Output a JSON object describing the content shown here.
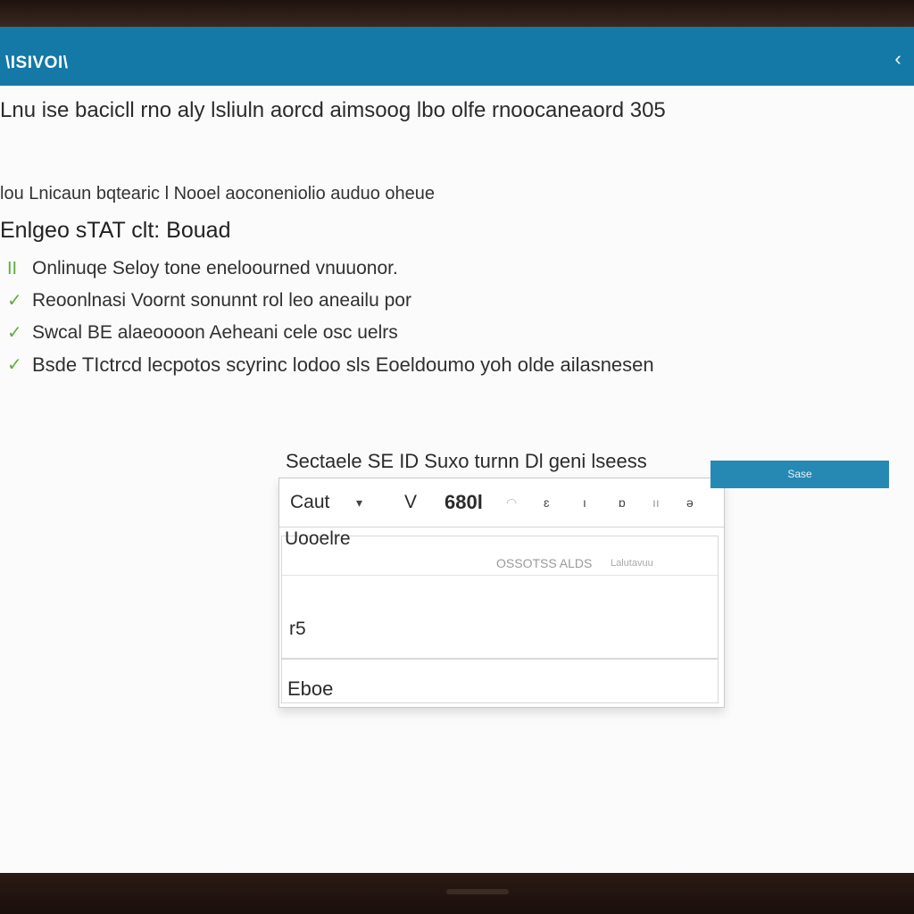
{
  "window": {
    "title": "\\ISIVOI\\",
    "back_icon": "chevron-left-icon"
  },
  "content": {
    "headline": "Lnu ise bacicll rno aly lsliuln aorcd aimsoog lbo olfe rnoocaneaord 305",
    "subline": "lou Lnicaun bqtearic l Nooel aoconeniolio auduo oheue",
    "section_title": "Enlgeo sTAT clt: Bouad",
    "checklist": [
      {
        "mark": "II",
        "text": "Onlinuqe Seloy tone eneloourned vnuuonor."
      },
      {
        "mark": "✓",
        "text": "Reoonlnasi Voornt sonunnt rol leo aneailu por"
      },
      {
        "mark": "✓",
        "text": "Swcal BE alaeoooon Aeheani cele osc uelrs"
      },
      {
        "mark": "✓",
        "text": "Bsde TIctrcd lecpotos scyrinc lodoo sls Eoeldoumo yoh olde ailasnesen"
      }
    ]
  },
  "dialog": {
    "caption": "Sectaele SE ID Suxo turnn Dl geni lseess",
    "toolbar": {
      "item1": "Caut",
      "item1_icon": "caret-icon",
      "item2": "V",
      "item3": "680l",
      "item4_icon": "spinner-icon",
      "item5": "ɛ",
      "item6": "ı",
      "item7": "ɒ",
      "item8": "ıı",
      "item9": "ə"
    },
    "field_label": "Uooelre",
    "field_hint": "OSSOTSS ALDS",
    "field_hint_small": "Lalutavuu",
    "field_value": "r5",
    "footer_label": "Eboe",
    "side_button": "Sase"
  },
  "colors": {
    "titlebar": "#1479a6",
    "accent_button": "#2689b4",
    "check_green": "#5cae3e"
  }
}
